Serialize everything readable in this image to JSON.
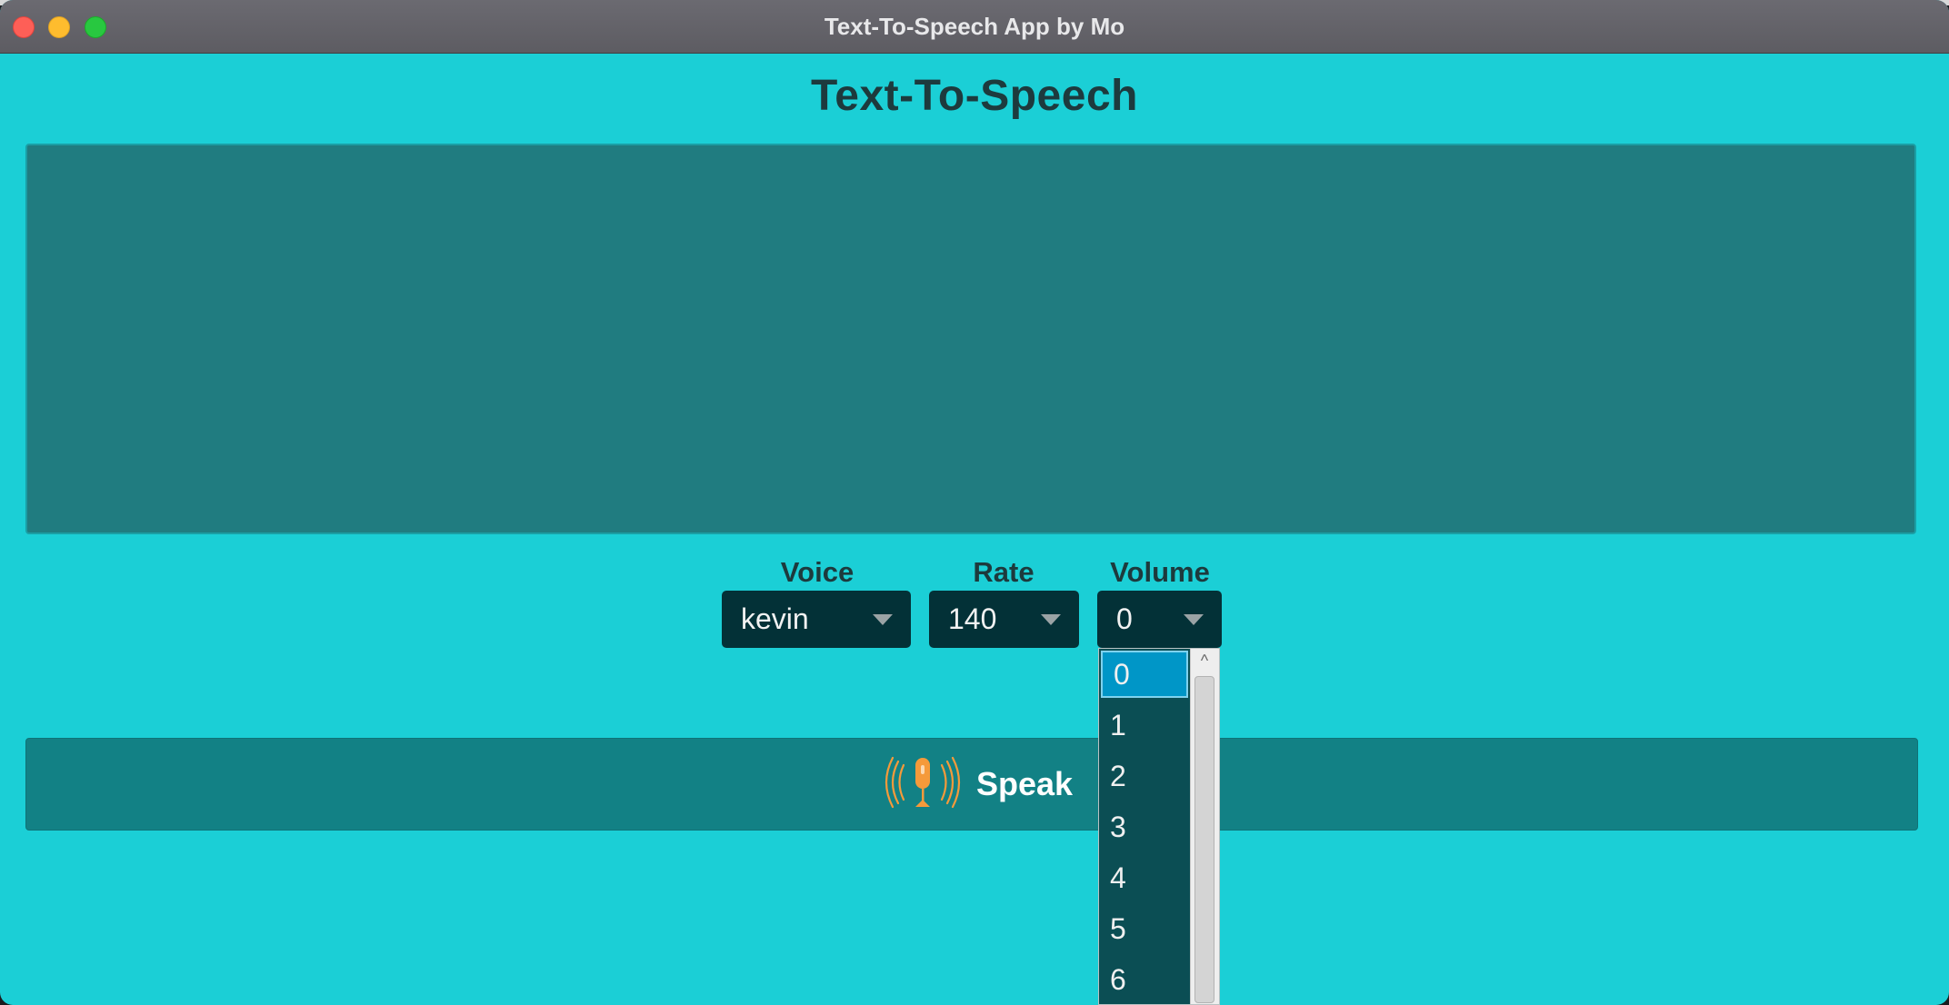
{
  "window": {
    "title": "Text-To-Speech App by Mo"
  },
  "header": {
    "title": "Text-To-Speech"
  },
  "text_input": {
    "value": ""
  },
  "controls": {
    "voice": {
      "label": "Voice",
      "value": "kevin"
    },
    "rate": {
      "label": "Rate",
      "value": "140"
    },
    "volume": {
      "label": "Volume",
      "value": "0"
    }
  },
  "volume_dropdown": {
    "options": [
      "0",
      "1",
      "2",
      "3",
      "4",
      "5",
      "6"
    ],
    "selected": "0",
    "scroll_up_glyph": "^"
  },
  "speak_button": {
    "label": "Speak",
    "icon": "microphone-broadcast-icon"
  },
  "colors": {
    "window_bg": "#1bcfd6",
    "textarea_bg": "#207c80",
    "combo_bg": "#033137",
    "button_bg": "#128185",
    "dropdown_bg": "#0b4e54",
    "dropdown_selected": "#0096c7",
    "icon_accent": "#f59a3a"
  }
}
